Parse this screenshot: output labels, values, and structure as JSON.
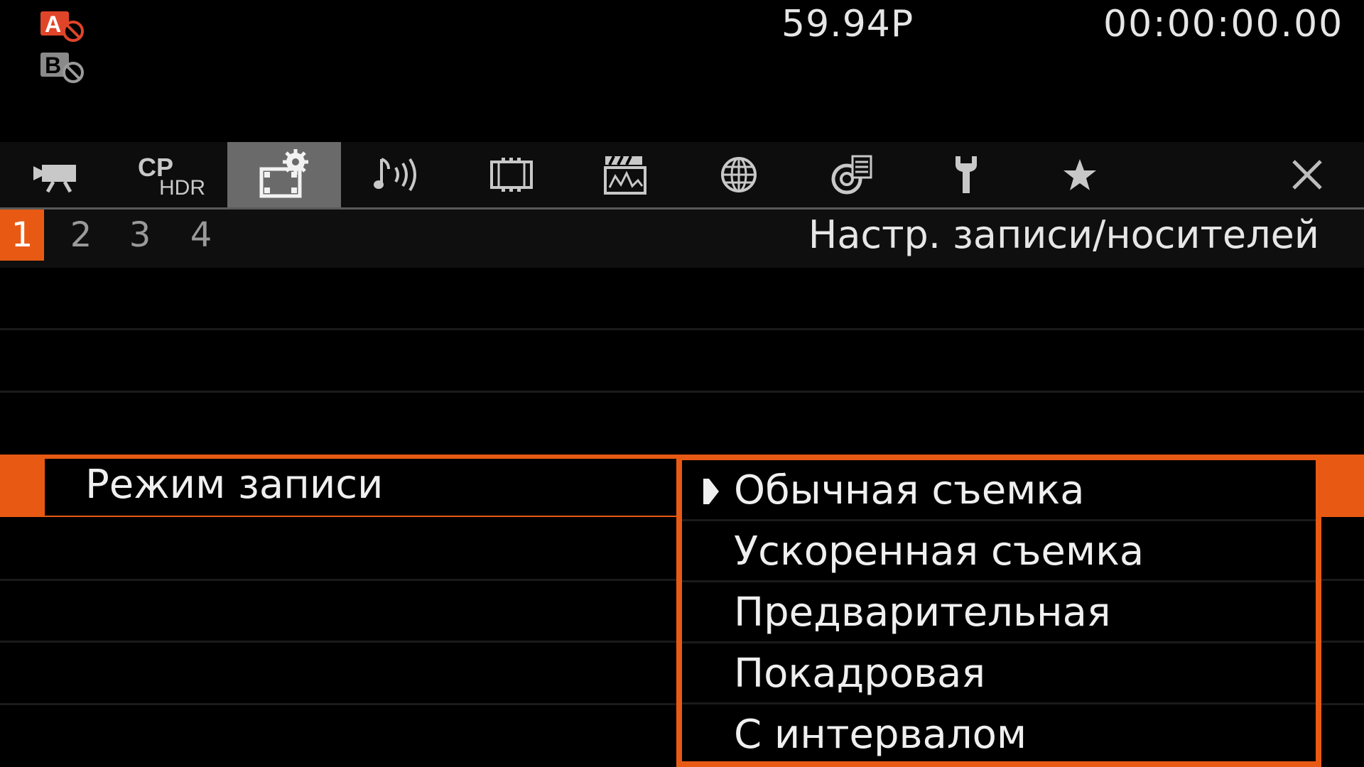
{
  "status": {
    "media_a_icon": "card-a-disabled-icon",
    "media_b_icon": "card-b-disabled-icon",
    "frame_rate": "59.94P",
    "timecode": "00:00:00.00",
    "timecode_mode": "P"
  },
  "tabs": [
    {
      "icon": "camera-icon",
      "active": false
    },
    {
      "icon": "cp-hdr-icon",
      "active": false
    },
    {
      "icon": "recording-setup-icon",
      "active": true
    },
    {
      "icon": "audio-icon",
      "active": false
    },
    {
      "icon": "film-frame-icon",
      "active": false
    },
    {
      "icon": "clapper-waveform-icon",
      "active": false
    },
    {
      "icon": "globe-icon",
      "active": false
    },
    {
      "icon": "display-assist-icon",
      "active": false
    },
    {
      "icon": "wrench-icon",
      "active": false
    },
    {
      "icon": "star-icon",
      "active": false
    },
    {
      "icon": "close-icon",
      "active": false
    }
  ],
  "pages": {
    "items": [
      "1",
      "2",
      "3",
      "4"
    ],
    "active": "1"
  },
  "section_title": "Настр. записи/носителей",
  "setting": {
    "label": "Режим записи"
  },
  "options": {
    "selected_index": 0,
    "items": [
      "Обычная съемка",
      "Ускоренная съемка",
      "Предварительная",
      "Покадровая",
      "С интервалом"
    ]
  },
  "colors": {
    "accent": "#e85a14",
    "tab_active": "#6a6a6a",
    "text": "#e8e8e8",
    "background": "#000000"
  }
}
